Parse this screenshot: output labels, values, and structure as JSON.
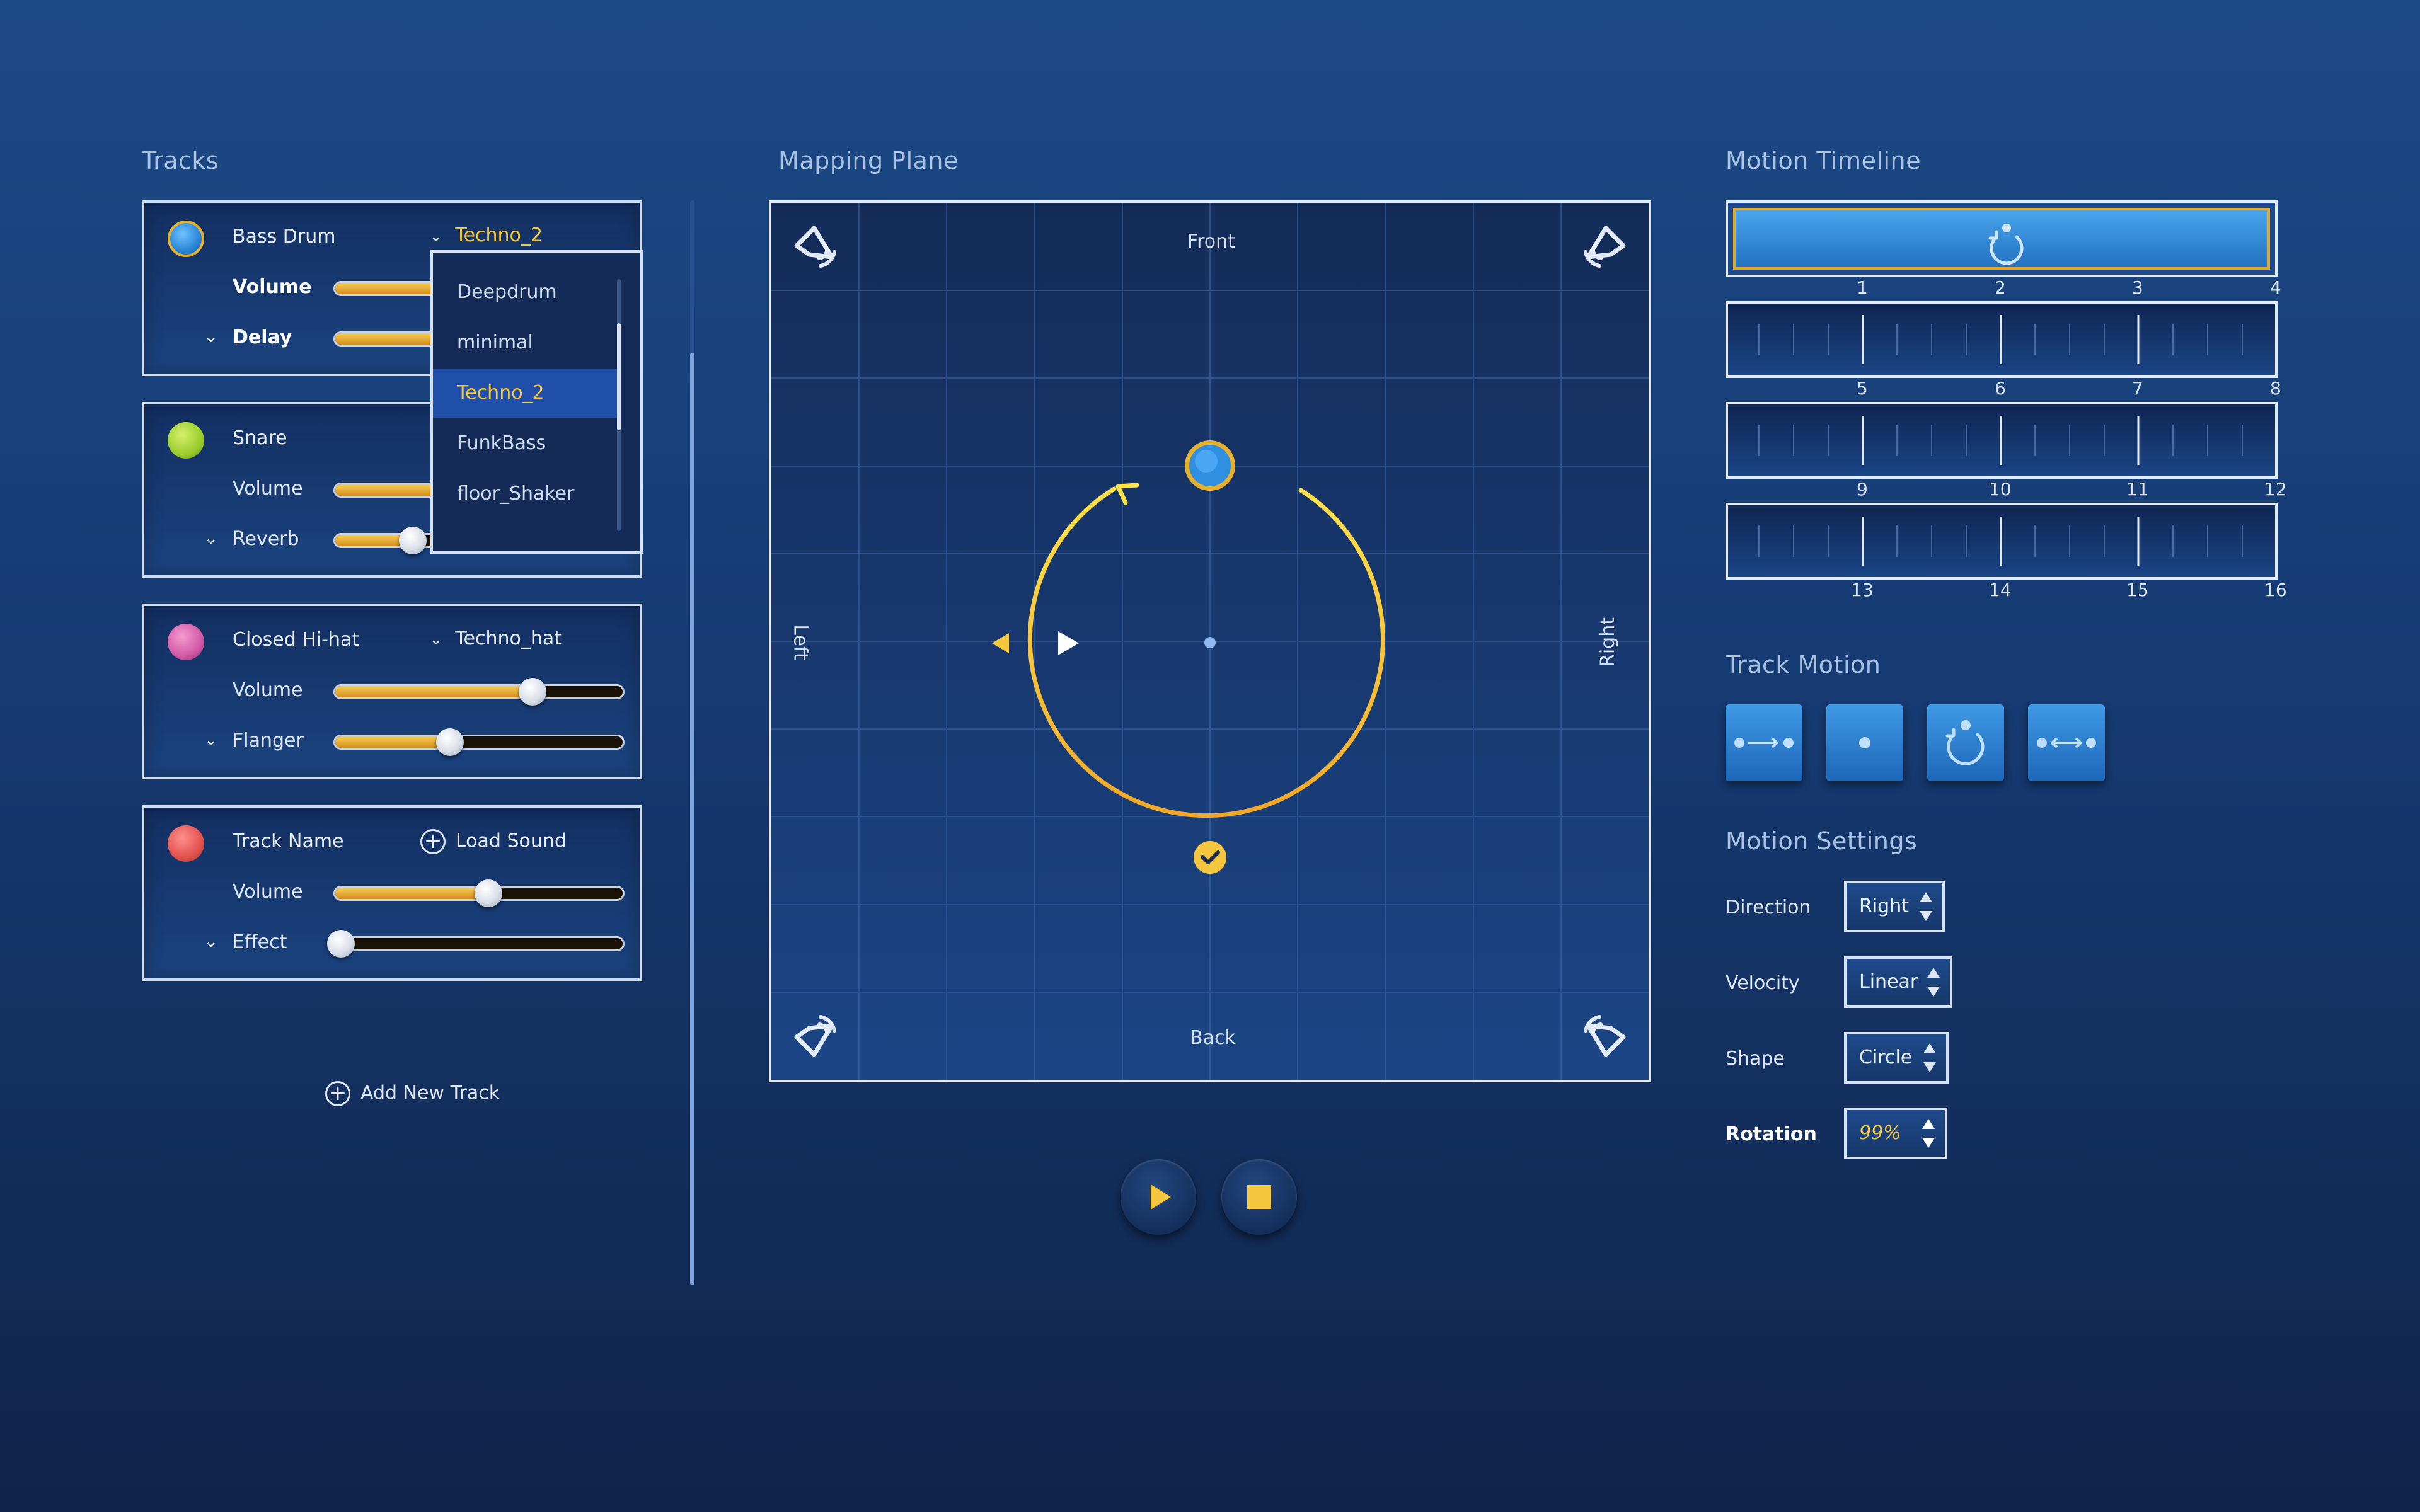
{
  "sections": {
    "tracks": "Tracks",
    "mapping_plane": "Mapping Plane",
    "motion_timeline": "Motion Timeline",
    "track_motion": "Track Motion",
    "motion_settings": "Motion Settings"
  },
  "colors": {
    "accent_gold": "#f5c73e",
    "blue": "#3e96e0",
    "green": "#9ccc2e",
    "pink": "#d25aa6",
    "red": "#e2524f"
  },
  "tracks": [
    {
      "name": "Bass Drum",
      "selector": "Techno_2",
      "row1": "Volume",
      "row2": "Delay",
      "volume": 0.62,
      "effect": 0.58
    },
    {
      "name": "Snare",
      "row1": "Volume",
      "row2": "Reverb",
      "volume": 0.6,
      "effect": 0.24
    },
    {
      "name": "Closed Hi-hat",
      "selector": "Techno_hat",
      "row1": "Volume",
      "row2": "Flanger",
      "volume": 0.7,
      "effect": 0.4
    },
    {
      "name": "Track Name",
      "load": "Load Sound",
      "row1": "Volume",
      "row2": "Effect",
      "volume": 0.55,
      "effect": 0.03
    }
  ],
  "dropdown": {
    "items": [
      "Deepdrum",
      "minimal",
      "Techno_2",
      "FunkBass",
      "floor_Shaker"
    ],
    "selected": "Techno_2"
  },
  "add_track": "Add New Track",
  "plane": {
    "front": "Front",
    "back": "Back",
    "left": "Left",
    "right": "Right",
    "icons": [
      "speaker-top-left-icon",
      "speaker-top-right-icon",
      "speaker-bottom-left-icon",
      "speaker-bottom-right-icon"
    ]
  },
  "timeline": {
    "rows": [
      [
        "1",
        "2",
        "3",
        "4"
      ],
      [
        "5",
        "6",
        "7",
        "8"
      ],
      [
        "9",
        "10",
        "11",
        "12"
      ],
      [
        "13",
        "14",
        "15",
        "16"
      ]
    ]
  },
  "track_motion_buttons": [
    "linear-motion-icon",
    "static-point-icon",
    "circular-motion-icon",
    "ping-pong-motion-icon"
  ],
  "settings": [
    {
      "label": "Direction",
      "value": "Right"
    },
    {
      "label": "Velocity",
      "value": "Linear"
    },
    {
      "label": "Shape",
      "value": "Circle"
    },
    {
      "label": "Rotation",
      "value": "99%"
    }
  ]
}
